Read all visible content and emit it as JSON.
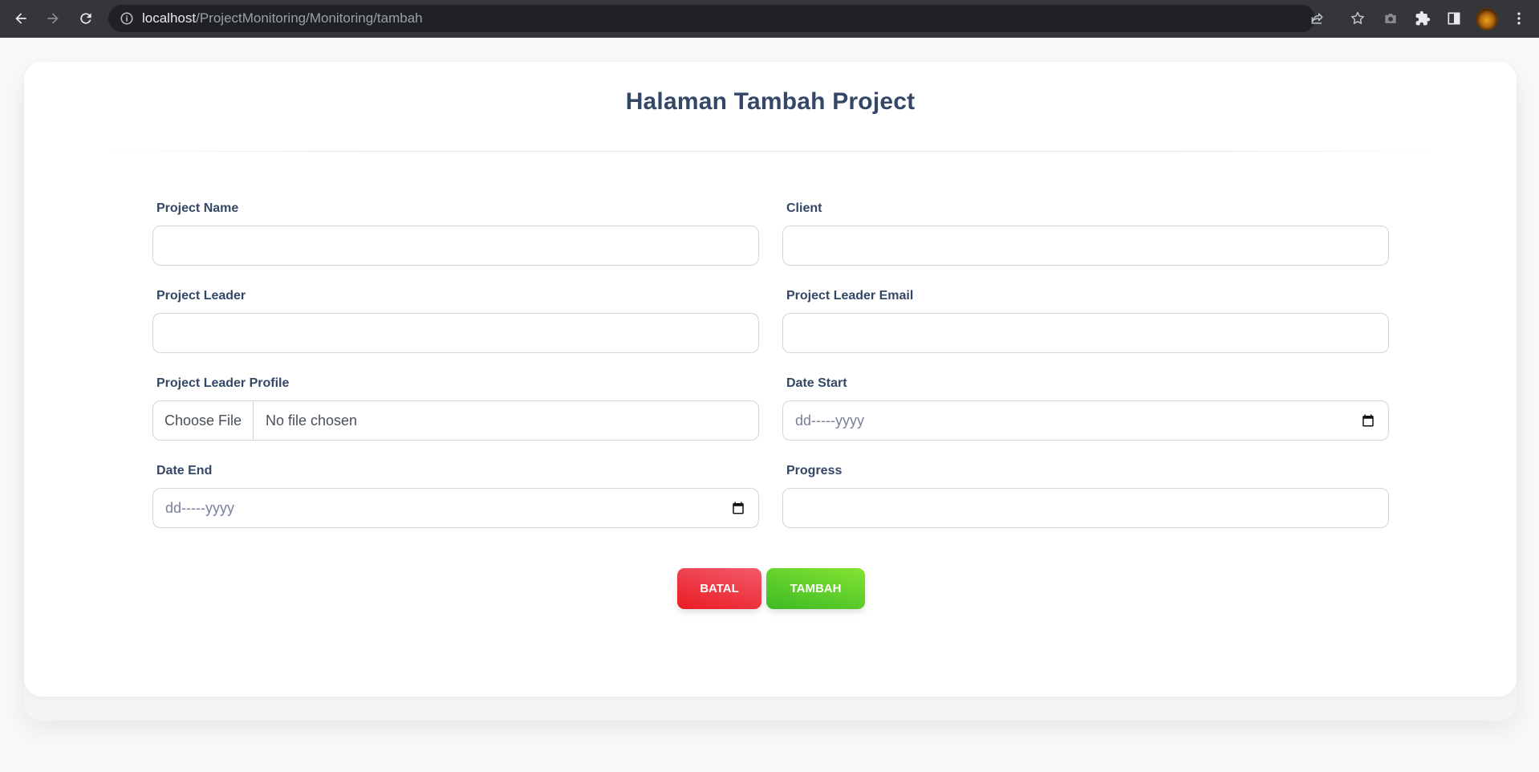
{
  "browser": {
    "url_host": "localhost",
    "url_path": "/ProjectMonitoring/Monitoring/tambah"
  },
  "page": {
    "title": "Halaman Tambah Project"
  },
  "form": {
    "project_name": {
      "label": "Project Name",
      "value": ""
    },
    "client": {
      "label": "Client",
      "value": ""
    },
    "project_leader": {
      "label": "Project Leader",
      "value": ""
    },
    "project_leader_email": {
      "label": "Project Leader Email",
      "value": ""
    },
    "project_leader_profile": {
      "label": "Project Leader Profile",
      "button": "Choose File",
      "status": "No file chosen"
    },
    "date_start": {
      "label": "Date Start",
      "placeholder": "dd-----yyyy"
    },
    "date_end": {
      "label": "Date End",
      "placeholder": "dd-----yyyy"
    },
    "progress": {
      "label": "Progress",
      "value": ""
    }
  },
  "buttons": {
    "batal": "BATAL",
    "tambah": "TAMBAH"
  },
  "colors": {
    "batal": "#ea1c23",
    "tambah": "#3dba24",
    "heading": "#344767",
    "toolbar": "#35363a"
  }
}
